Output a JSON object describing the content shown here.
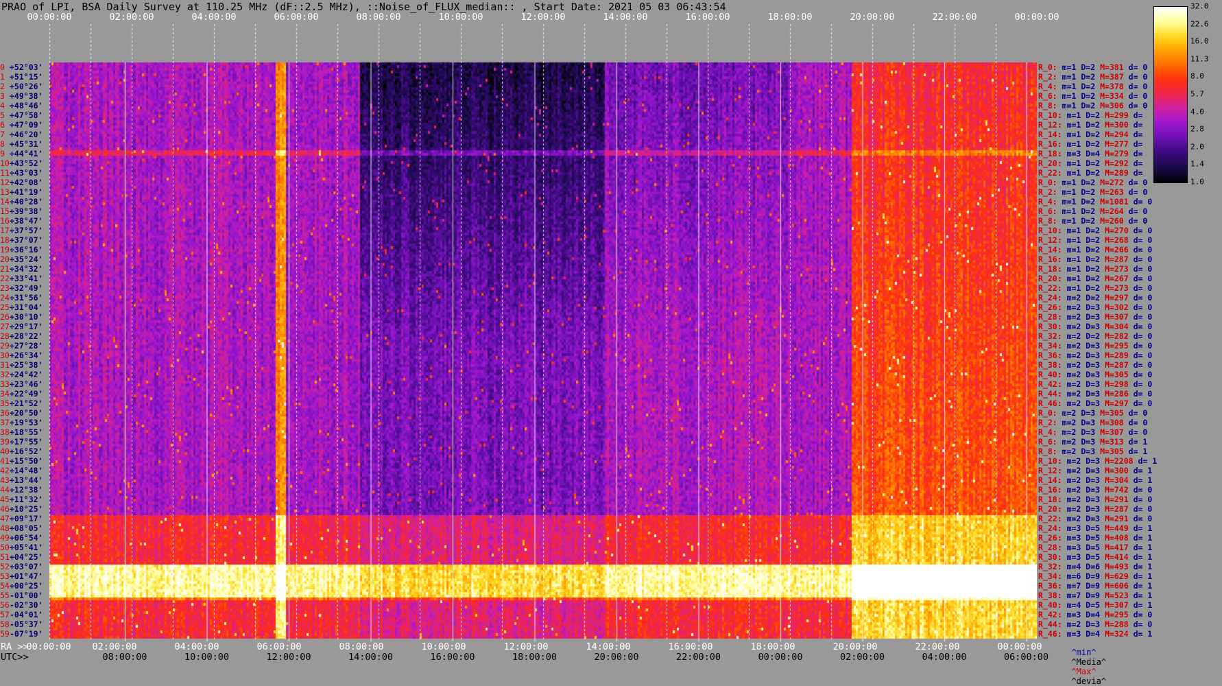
{
  "title": "PRAO of LPI, BSA Daily Survey at 110.25 MHz (dF::2.5 MHz), ::Noise_of_FLUX_median:: , Start Date: 2021 05 03 06:43:54",
  "top_time_labels": [
    "00:00:00",
    "02:00:00",
    "04:00:00",
    "06:00:00",
    "08:00:00",
    "10:00:00",
    "12:00:00",
    "14:00:00",
    "16:00:00",
    "18:00:00",
    "20:00:00",
    "22:00:00",
    "00:00:00"
  ],
  "ra_caption": "RA >>",
  "utc_caption": "UTC>>",
  "ra_labels": [
    "00:00:00",
    "02:00:00",
    "04:00:00",
    "06:00:00",
    "08:00:00",
    "10:00:00",
    "12:00:00",
    "14:00:00",
    "16:00:00",
    "18:00:00",
    "20:00:00",
    "22:00:00",
    "00:00:00"
  ],
  "utc_labels": [
    "08:00:00",
    "10:00:00",
    "12:00:00",
    "14:00:00",
    "16:00:00",
    "18:00:00",
    "20:00:00",
    "22:00:00",
    "00:00:00",
    "02:00:00",
    "04:00:00",
    "06:00:00"
  ],
  "colorbar": {
    "tick_labels": [
      "32.0",
      "22.6",
      "16.0",
      "11.3",
      "8.0",
      "5.7",
      "4.0",
      "2.8",
      "2.0",
      "1.4",
      "1.0"
    ],
    "colors": [
      "#000000",
      "#1a0a4a",
      "#3a0a7a",
      "#6a10b0",
      "#9a16d0",
      "#cc20a8",
      "#ee2450",
      "#ff3010",
      "#ff6a00",
      "#ffa000",
      "#ffd820",
      "#ffffa0",
      "#ffffff"
    ]
  },
  "dec_labels": [
    "+52°03'",
    "+51°15'",
    "+50°26'",
    "+49°38'",
    "+48°46'",
    "+47°58'",
    "+47°09'",
    "+46°20'",
    "+45°31'",
    "+44°41'",
    "+43°52'",
    "+43°03'",
    "+42°08'",
    "+41°19'",
    "+40°28'",
    "+39°38'",
    "+38°47'",
    "+37°57'",
    "+37°07'",
    "+36°16'",
    "+35°24'",
    "+34°32'",
    "+33°41'",
    "+32°49'",
    "+31°56'",
    "+31°04'",
    "+30°10'",
    "+29°17'",
    "+28°22'",
    "+27°28'",
    "+26°34'",
    "+25°38'",
    "+24°42'",
    "+23°46'",
    "+22°49'",
    "+21°52'",
    "+20°50'",
    "+19°53'",
    "+18°55'",
    "+17°55'",
    "+16°52'",
    "+15°50'",
    "+14°48'",
    "+13°44'",
    "+12°38'",
    "+11°32'",
    "+10°25'",
    "+09°17'",
    "+08°05'",
    "+06°54'",
    "+05°41'",
    "+04°25'",
    "+03°07'",
    "+01°47'",
    "+00°25'",
    "-01°00'",
    "-02°30'",
    "-04°01'",
    "-05°37'",
    "-07°19'"
  ],
  "stats_rows": [
    {
      "r": "R_0:",
      "m": "m=1",
      "d": "D=2",
      "mm": "M=381",
      "dev": "d= 0"
    },
    {
      "r": "R_2:",
      "m": "m=1",
      "d": "D=2",
      "mm": "M=387",
      "dev": "d= 0"
    },
    {
      "r": "R_4:",
      "m": "m=1",
      "d": "D=2",
      "mm": "M=378",
      "dev": "d= 0"
    },
    {
      "r": "R_6:",
      "m": "m=1",
      "d": "D=2",
      "mm": "M=334",
      "dev": "d= 0"
    },
    {
      "r": "R_8:",
      "m": "m=1",
      "d": "D=2",
      "mm": "M=306",
      "dev": "d= 0"
    },
    {
      "r": "R_10:",
      "m": "m=1",
      "d": "D=2",
      "mm": "M=299",
      "dev": "d="
    },
    {
      "r": "R_12:",
      "m": "m=1",
      "d": "D=2",
      "mm": "M=300",
      "dev": "d="
    },
    {
      "r": "R_14:",
      "m": "m=1",
      "d": "D=2",
      "mm": "M=294",
      "dev": "d="
    },
    {
      "r": "R_16:",
      "m": "m=1",
      "d": "D=2",
      "mm": "M=277",
      "dev": "d="
    },
    {
      "r": "R_18:",
      "m": "m=3",
      "d": "D=4",
      "mm": "M=279",
      "dev": "d="
    },
    {
      "r": "R_20:",
      "m": "m=1",
      "d": "D=2",
      "mm": "M=292",
      "dev": "d="
    },
    {
      "r": "R_22:",
      "m": "m=1",
      "d": "D=2",
      "mm": "M=289",
      "dev": "d="
    },
    {
      "r": "R_0:",
      "m": "m=1",
      "d": "D=2",
      "mm": "M=272",
      "dev": "d= 0"
    },
    {
      "r": "R_2:",
      "m": "m=1",
      "d": "D=2",
      "mm": "M=263",
      "dev": "d= 0"
    },
    {
      "r": "R_4:",
      "m": "m=1",
      "d": "D=2",
      "mm": "M=1081",
      "dev": "d= 0"
    },
    {
      "r": "R_6:",
      "m": "m=1",
      "d": "D=2",
      "mm": "M=264",
      "dev": "d= 0"
    },
    {
      "r": "R_8:",
      "m": "m=1",
      "d": "D=2",
      "mm": "M=260",
      "dev": "d= 0"
    },
    {
      "r": "R_10:",
      "m": "m=1",
      "d": "D=2",
      "mm": "M=270",
      "dev": "d= 0"
    },
    {
      "r": "R_12:",
      "m": "m=1",
      "d": "D=2",
      "mm": "M=268",
      "dev": "d= 0"
    },
    {
      "r": "R_14:",
      "m": "m=1",
      "d": "D=2",
      "mm": "M=266",
      "dev": "d= 0"
    },
    {
      "r": "R_16:",
      "m": "m=1",
      "d": "D=2",
      "mm": "M=287",
      "dev": "d= 0"
    },
    {
      "r": "R_18:",
      "m": "m=1",
      "d": "D=2",
      "mm": "M=273",
      "dev": "d= 0"
    },
    {
      "r": "R_20:",
      "m": "m=1",
      "d": "D=2",
      "mm": "M=267",
      "dev": "d= 0"
    },
    {
      "r": "R_22:",
      "m": "m=1",
      "d": "D=2",
      "mm": "M=273",
      "dev": "d= 0"
    },
    {
      "r": "R_24:",
      "m": "m=2",
      "d": "D=2",
      "mm": "M=297",
      "dev": "d= 0"
    },
    {
      "r": "R_26:",
      "m": "m=2",
      "d": "D=3",
      "mm": "M=302",
      "dev": "d= 0"
    },
    {
      "r": "R_28:",
      "m": "m=2",
      "d": "D=3",
      "mm": "M=307",
      "dev": "d= 0"
    },
    {
      "r": "R_30:",
      "m": "m=2",
      "d": "D=3",
      "mm": "M=304",
      "dev": "d= 0"
    },
    {
      "r": "R_32:",
      "m": "m=2",
      "d": "D=2",
      "mm": "M=282",
      "dev": "d= 0"
    },
    {
      "r": "R_34:",
      "m": "m=2",
      "d": "D=3",
      "mm": "M=295",
      "dev": "d= 0"
    },
    {
      "r": "R_36:",
      "m": "m=2",
      "d": "D=3",
      "mm": "M=289",
      "dev": "d= 0"
    },
    {
      "r": "R_38:",
      "m": "m=2",
      "d": "D=3",
      "mm": "M=287",
      "dev": "d= 0"
    },
    {
      "r": "R_40:",
      "m": "m=2",
      "d": "D=3",
      "mm": "M=305",
      "dev": "d= 0"
    },
    {
      "r": "R_42:",
      "m": "m=2",
      "d": "D=3",
      "mm": "M=298",
      "dev": "d= 0"
    },
    {
      "r": "R_44:",
      "m": "m=2",
      "d": "D=3",
      "mm": "M=286",
      "dev": "d= 0"
    },
    {
      "r": "R_46:",
      "m": "m=2",
      "d": "D=3",
      "mm": "M=297",
      "dev": "d= 0"
    },
    {
      "r": "R_0:",
      "m": "m=2",
      "d": "D=3",
      "mm": "M=305",
      "dev": "d= 0"
    },
    {
      "r": "R_2:",
      "m": "m=2",
      "d": "D=3",
      "mm": "M=308",
      "dev": "d= 0"
    },
    {
      "r": "R_4:",
      "m": "m=2",
      "d": "D=3",
      "mm": "M=307",
      "dev": "d= 0"
    },
    {
      "r": "R_6:",
      "m": "m=2",
      "d": "D=3",
      "mm": "M=313",
      "dev": "d= 1"
    },
    {
      "r": "R_8:",
      "m": "m=2",
      "d": "D=3",
      "mm": "M=305",
      "dev": "d= 1"
    },
    {
      "r": "R_10:",
      "m": "m=2",
      "d": "D=3",
      "mm": "M=2208",
      "dev": "d= 1"
    },
    {
      "r": "R_12:",
      "m": "m=2",
      "d": "D=3",
      "mm": "M=300",
      "dev": "d= 1"
    },
    {
      "r": "R_14:",
      "m": "m=2",
      "d": "D=3",
      "mm": "M=304",
      "dev": "d= 1"
    },
    {
      "r": "R_16:",
      "m": "m=2",
      "d": "D=3",
      "mm": "M=742",
      "dev": "d= 0"
    },
    {
      "r": "R_18:",
      "m": "m=2",
      "d": "D=3",
      "mm": "M=291",
      "dev": "d= 0"
    },
    {
      "r": "R_20:",
      "m": "m=2",
      "d": "D=3",
      "mm": "M=287",
      "dev": "d= 0"
    },
    {
      "r": "R_22:",
      "m": "m=2",
      "d": "D=3",
      "mm": "M=291",
      "dev": "d= 0"
    },
    {
      "r": "R_24:",
      "m": "m=3",
      "d": "D=5",
      "mm": "M=449",
      "dev": "d= 1"
    },
    {
      "r": "R_26:",
      "m": "m=3",
      "d": "D=5",
      "mm": "M=408",
      "dev": "d= 1"
    },
    {
      "r": "R_28:",
      "m": "m=3",
      "d": "D=5",
      "mm": "M=417",
      "dev": "d= 1"
    },
    {
      "r": "R_30:",
      "m": "m=3",
      "d": "D=5",
      "mm": "M=414",
      "dev": "d= 1"
    },
    {
      "r": "R_32:",
      "m": "m=4",
      "d": "D=6",
      "mm": "M=493",
      "dev": "d= 1"
    },
    {
      "r": "R_34:",
      "m": "m=6",
      "d": "D=9",
      "mm": "M=629",
      "dev": "d= 1"
    },
    {
      "r": "R_36:",
      "m": "m=7",
      "d": "D=9",
      "mm": "M=606",
      "dev": "d= 1"
    },
    {
      "r": "R_38:",
      "m": "m=7",
      "d": "D=9",
      "mm": "M=523",
      "dev": "d= 1"
    },
    {
      "r": "R_40:",
      "m": "m=4",
      "d": "D=5",
      "mm": "M=307",
      "dev": "d= 1"
    },
    {
      "r": "R_42:",
      "m": "m=3",
      "d": "D=4",
      "mm": "M=295",
      "dev": "d= 0"
    },
    {
      "r": "R_44:",
      "m": "m=2",
      "d": "D=3",
      "mm": "M=288",
      "dev": "d= 0"
    },
    {
      "r": "R_46:",
      "m": "m=3",
      "d": "D=4",
      "mm": "M=324",
      "dev": "d= 1"
    }
  ],
  "legend": {
    "min": "^min^",
    "median": "^Media^",
    "max": "^Max^",
    "dev": "^devia^"
  },
  "chart_data": {
    "type": "heatmap",
    "title": "PRAO of LPI, BSA Daily Survey at 110.25 MHz (dF::2.5 MHz), ::Noise_of_FLUX_median:: , Start Date: 2021 05 03 06:43:54",
    "x_axis_ra": [
      "00:00:00",
      "02:00:00",
      "04:00:00",
      "06:00:00",
      "08:00:00",
      "10:00:00",
      "12:00:00",
      "14:00:00",
      "16:00:00",
      "18:00:00",
      "20:00:00",
      "22:00:00",
      "00:00:00"
    ],
    "x_axis_utc": [
      "08:00:00",
      "10:00:00",
      "12:00:00",
      "14:00:00",
      "16:00:00",
      "18:00:00",
      "20:00:00",
      "22:00:00",
      "00:00:00",
      "02:00:00",
      "04:00:00",
      "06:00:00"
    ],
    "y_axis_declination_range": [
      "+52°03'",
      "-07°19'"
    ],
    "color_scale": "log",
    "color_range": [
      1.0,
      32.0
    ],
    "hot_regions_hours_ra": [
      {
        "ra_start": 5.5,
        "ra_end": 5.7,
        "dec_band": "all",
        "level": "high"
      },
      {
        "ra_start": 19.5,
        "ra_end": 24.0,
        "dec_band": "south",
        "level": "high"
      },
      {
        "ra_start": 0.0,
        "ra_end": 24.0,
        "dec_band": "+01°47' to -01°00'",
        "level": "very high"
      }
    ]
  }
}
